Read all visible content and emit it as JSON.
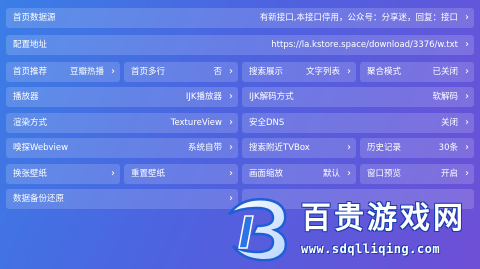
{
  "rows": {
    "homepage_source": {
      "label": "首页数据源",
      "value": "有新接口,本接口停用，公众号：分享迷，回复：接口"
    },
    "config_address": {
      "label": "配置地址",
      "value": "https://la.kstore.space/download/3376/w.txt"
    },
    "home_recommend": {
      "label": "首页推荐",
      "value": "豆瓣热播"
    },
    "home_multiline": {
      "label": "首页多行",
      "value": "否"
    },
    "search_display": {
      "label": "搜索展示",
      "value": "文字列表"
    },
    "aggregate_mode": {
      "label": "聚合模式",
      "value": "已关闭"
    },
    "player": {
      "label": "播放器",
      "value": "IJK播放器"
    },
    "ijk_decode": {
      "label": "IJK解码方式",
      "value": "软解码"
    },
    "render_mode": {
      "label": "渲染方式",
      "value": "TextureView"
    },
    "secure_dns": {
      "label": "安全DNS",
      "value": "关闭"
    },
    "sniff_webview": {
      "label": "嗅探Webview",
      "value": "系统自带"
    },
    "search_nearby": {
      "label": "搜索附近TVBox",
      "value": ""
    },
    "history": {
      "label": "历史记录",
      "value": "30条"
    },
    "change_wallpaper": {
      "label": "换张壁纸"
    },
    "reset_wallpaper": {
      "label": "重置壁纸"
    },
    "screen_scale": {
      "label": "画面缩放",
      "value": "默认"
    },
    "window_preview": {
      "label": "窗口预览",
      "value": "开启"
    },
    "data_backup": {
      "label": "数据备份还原"
    }
  },
  "chevron": "›",
  "watermark": {
    "title": "百贵游戏网",
    "url": "www.sdqlliqing.com",
    "logo_letter": "B"
  }
}
